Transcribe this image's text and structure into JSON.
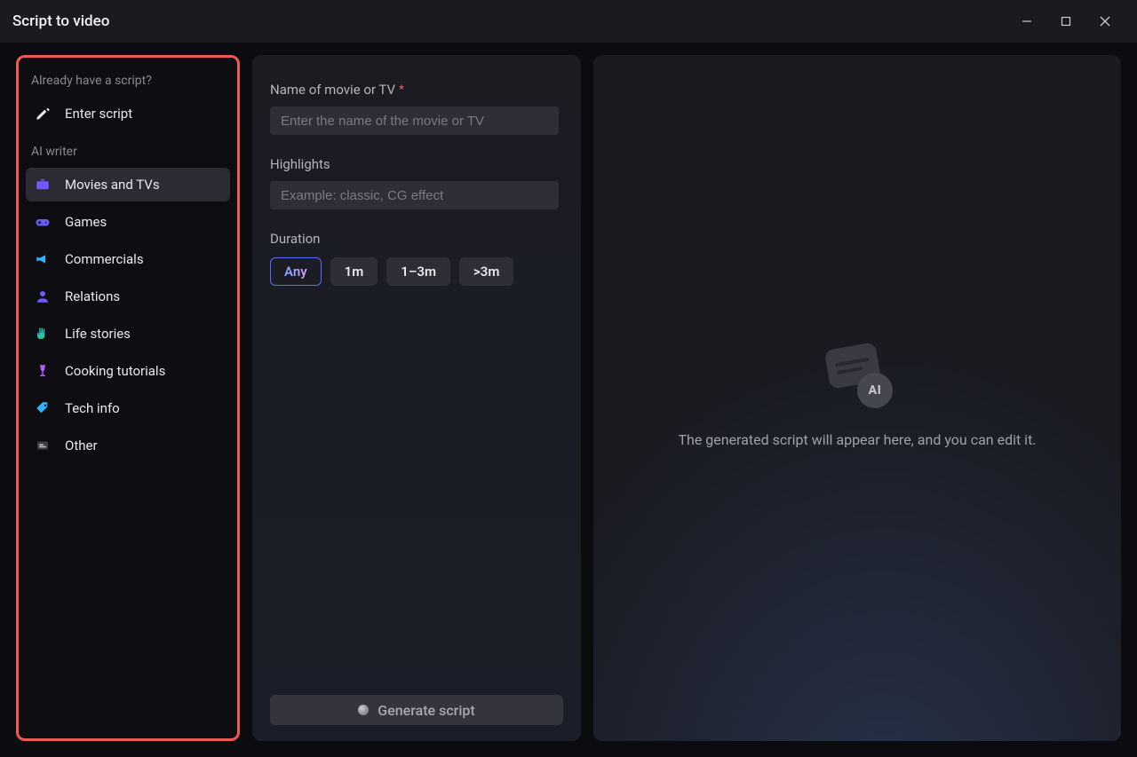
{
  "window": {
    "title": "Script to video"
  },
  "sidebar": {
    "section_have_script": "Already have a script?",
    "enter_script": "Enter script",
    "section_ai_writer": "AI writer",
    "categories": [
      {
        "label": "Movies and TVs",
        "selected": true,
        "icon": "tv"
      },
      {
        "label": "Games",
        "selected": false,
        "icon": "gamepad"
      },
      {
        "label": "Commercials",
        "selected": false,
        "icon": "megaphone"
      },
      {
        "label": "Relations",
        "selected": false,
        "icon": "person"
      },
      {
        "label": "Life stories",
        "selected": false,
        "icon": "hand"
      },
      {
        "label": "Cooking tutorials",
        "selected": false,
        "icon": "wine"
      },
      {
        "label": "Tech info",
        "selected": false,
        "icon": "tag"
      },
      {
        "label": "Other",
        "selected": false,
        "icon": "other"
      }
    ]
  },
  "form": {
    "name_label": "Name of movie or TV",
    "name_required": "*",
    "name_placeholder": "Enter the name of the movie or TV",
    "highlights_label": "Highlights",
    "highlights_placeholder": "Example: classic, CG effect",
    "duration_label": "Duration",
    "durations": [
      {
        "label": "Any",
        "active": true
      },
      {
        "label": "1m",
        "active": false
      },
      {
        "label": "1–3m",
        "active": false
      },
      {
        "label": ">3m",
        "active": false
      }
    ],
    "generate_button": "Generate script"
  },
  "preview": {
    "badge_text": "AI",
    "placeholder_text": "The generated script will appear here, and you can edit it."
  }
}
